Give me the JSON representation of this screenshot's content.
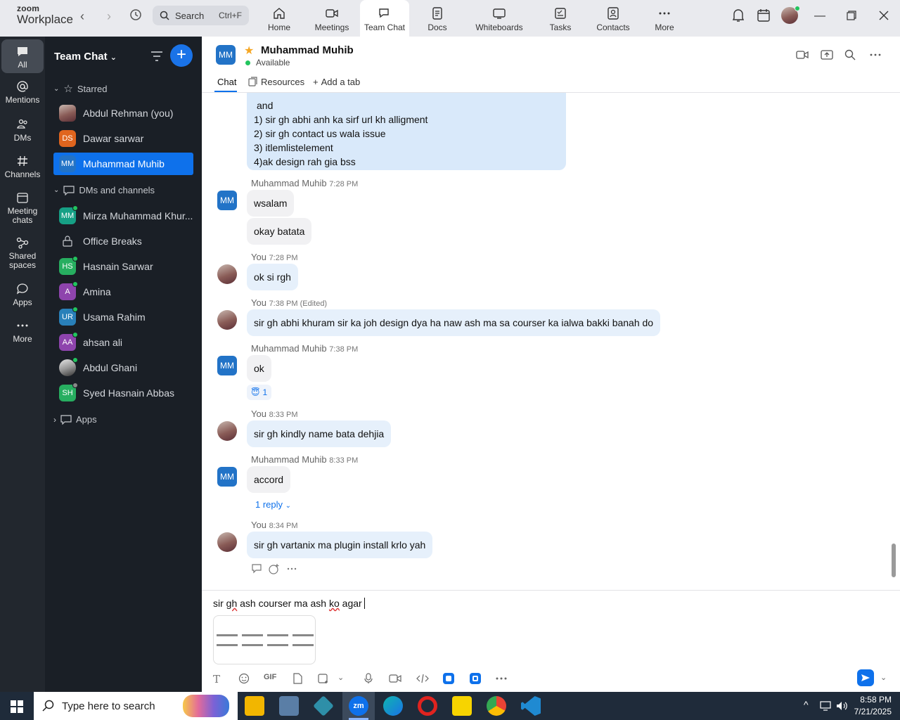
{
  "topbar": {
    "brand_top": "zoom",
    "brand_bottom": "Workplace",
    "search_placeholder": "Search",
    "search_shortcut": "Ctrl+F",
    "tabs": [
      {
        "label": "Home",
        "icon": "home-icon"
      },
      {
        "label": "Meetings",
        "icon": "video-camera-icon"
      },
      {
        "label": "Team Chat",
        "icon": "chat-bubble-icon"
      },
      {
        "label": "Docs",
        "icon": "document-icon"
      },
      {
        "label": "Whiteboards",
        "icon": "whiteboard-icon"
      },
      {
        "label": "Tasks",
        "icon": "tasks-icon"
      },
      {
        "label": "Contacts",
        "icon": "contacts-icon"
      },
      {
        "label": "More",
        "icon": "ellipsis-icon"
      }
    ],
    "active_tab": "Team Chat"
  },
  "rail": {
    "items": [
      {
        "label": "All",
        "icon": "chat-icon"
      },
      {
        "label": "Mentions",
        "icon": "at-icon"
      },
      {
        "label": "DMs",
        "icon": "people-icon"
      },
      {
        "label": "Channels",
        "icon": "hash-icon"
      },
      {
        "label": "Meeting chats",
        "icon": "calendar-icon"
      },
      {
        "label": "Shared spaces",
        "icon": "share-icon"
      },
      {
        "label": "Apps",
        "icon": "app-bubble-icon"
      },
      {
        "label": "More",
        "icon": "ellipsis-icon"
      }
    ]
  },
  "panel": {
    "title": "Team Chat",
    "starred_label": "Starred",
    "starred": [
      {
        "name": "Abdul Rehman (you)",
        "initials": "",
        "color": "#8a5c57",
        "photo": true
      },
      {
        "name": "Dawar sarwar",
        "initials": "DS",
        "color": "#e0651e"
      },
      {
        "name": "Muhammad Muhib",
        "initials": "MM",
        "color": "#2273c7",
        "selected": true
      }
    ],
    "dms_label": "DMs and channels",
    "dms": [
      {
        "name": "Mirza Muhammad Khur...",
        "initials": "MM",
        "color": "#16a085",
        "status": "online"
      },
      {
        "name": "Office Breaks",
        "initials": "",
        "color": "",
        "lock": true
      },
      {
        "name": "Hasnain Sarwar",
        "initials": "HS",
        "color": "#27ae60",
        "status": "online"
      },
      {
        "name": "Amina",
        "initials": "A",
        "color": "#8e44ad",
        "status": "mobile"
      },
      {
        "name": "Usama Rahim",
        "initials": "UR",
        "color": "#2980b9",
        "status": "online"
      },
      {
        "name": "ahsan ali",
        "initials": "AA",
        "color": "#8e44ad",
        "status": "online"
      },
      {
        "name": "Abdul Ghani",
        "initials": "",
        "color": "#555",
        "photo2": true,
        "status": "online"
      },
      {
        "name": "Syed Hasnain Abbas",
        "initials": "SH",
        "color": "#27ae60",
        "status": "away"
      }
    ],
    "apps_label": "Apps"
  },
  "chat_header": {
    "initials": "MM",
    "name": "Muhammad Muhib",
    "status": "Available",
    "tabs": [
      "Chat",
      "Resources",
      "Add a tab"
    ]
  },
  "messages": {
    "list_block": [
      "and",
      "1)  sir gh abhi anh ka sirf url kh alligment",
      "2) sir gh  contact us wala issue",
      "3) itlemlistelement",
      "4)ak design rah gia bss"
    ],
    "m1_sender": "Muhammad Muhib",
    "m1_time": "7:28 PM",
    "m1_text_a": "wsalam",
    "m1_text_b": "okay batata",
    "m2_sender": "You",
    "m2_time": "7:28 PM",
    "m2_text": "ok si rgh",
    "m3_sender": "You",
    "m3_time": "7:38 PM (Edited)",
    "m3_text": "sir gh abhi khuram sir ka joh design dya ha naw ash ma sa courser ka ialwa bakki banah  do",
    "m4_sender": "Muhammad Muhib",
    "m4_time": "7:38 PM",
    "m4_text": "ok",
    "m4_reaction_count": "1",
    "m5_sender": "You",
    "m5_time": "8:33 PM",
    "m5_text": "sir gh kindly name bata dehjia",
    "m6_sender": "Muhammad Muhib",
    "m6_time": "8:33 PM",
    "m6_text": "accord",
    "m6_replies": "1 reply",
    "m7_sender": "You",
    "m7_time": "8:34 PM",
    "m7_text": "sir gh vartanix ma plugin install krlo yah",
    "initials_other": "MM"
  },
  "composer": {
    "text_a": "sir ",
    "text_b": "gh",
    "text_c": " ash courser ma ash ",
    "text_d": "ko",
    "text_e": " agar",
    "gif_label": "GIF"
  },
  "taskbar": {
    "search_placeholder": "Type here to search",
    "time": "8:58 PM",
    "date": "7/21/2025"
  },
  "colors": {
    "accent": "#0e71eb",
    "rail_bg": "#22272e",
    "panel_bg": "#1a1f26",
    "online": "#22c55e"
  }
}
